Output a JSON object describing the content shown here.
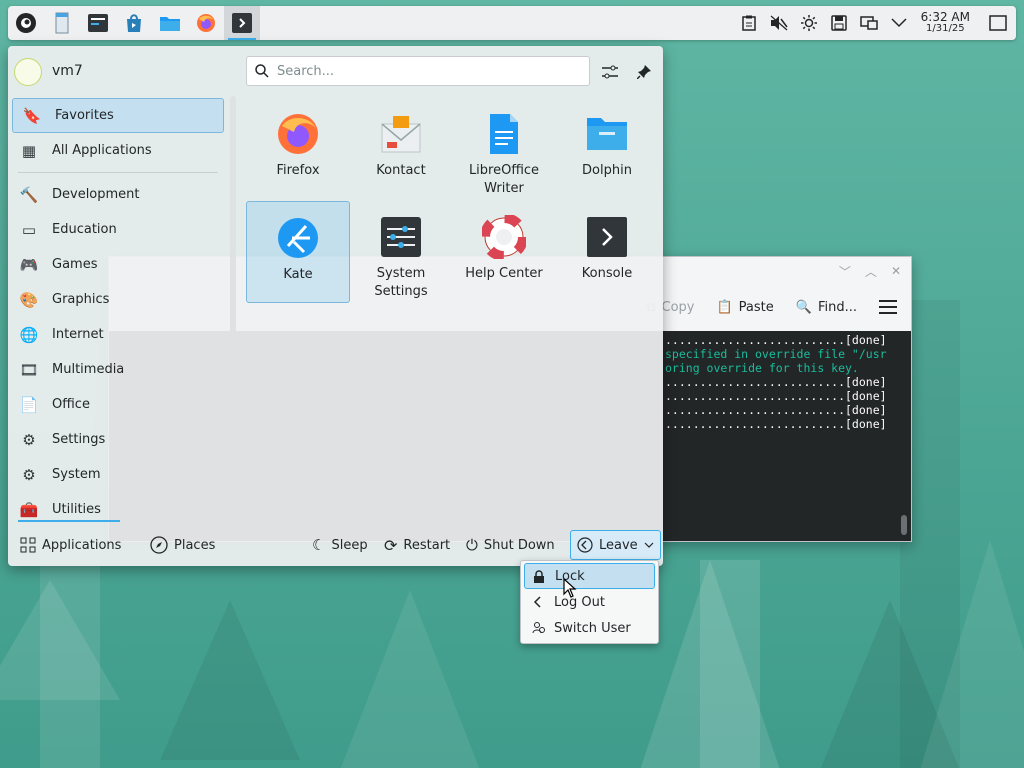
{
  "panel": {
    "clock_time": "6:32 AM",
    "clock_date": "1/31/25"
  },
  "terminal": {
    "toolbar": {
      "copy": "Copy",
      "paste": "Paste",
      "find": "Find..."
    },
    "lines": [
      {
        "text": "..........................[done]",
        "color": "#fcfcfc"
      },
      {
        "text": "specified in override file \"/usr",
        "color": "#1abc9c"
      },
      {
        "text": "oring override for this key.",
        "color": "#1abc9c"
      },
      {
        "text": "..........................[done]",
        "color": "#fcfcfc"
      },
      {
        "text": "..........................[done]",
        "color": "#fcfcfc"
      },
      {
        "text": "..........................[done]",
        "color": "#fcfcfc"
      },
      {
        "text": "..........................[done]",
        "color": "#fcfcfc"
      }
    ]
  },
  "launcher": {
    "username": "vm7",
    "search_placeholder": "Search...",
    "categories": [
      {
        "label": "Favorites",
        "icon": "bookmark-icon",
        "glyph": "🔖",
        "selected": true
      },
      {
        "label": "All Applications",
        "icon": "grid-icon",
        "glyph": "▦",
        "selected": false
      }
    ],
    "categories2": [
      {
        "label": "Development",
        "icon": "hammer-icon",
        "glyph": "🔨"
      },
      {
        "label": "Education",
        "icon": "board-icon",
        "glyph": "▭"
      },
      {
        "label": "Games",
        "icon": "gamepad-icon",
        "glyph": "🎮"
      },
      {
        "label": "Graphics",
        "icon": "palette-icon",
        "glyph": "🎨"
      },
      {
        "label": "Internet",
        "icon": "globe-icon",
        "glyph": "🌐"
      },
      {
        "label": "Multimedia",
        "icon": "film-icon",
        "glyph": "🎞"
      },
      {
        "label": "Office",
        "icon": "document-icon",
        "glyph": "📄"
      },
      {
        "label": "Settings",
        "icon": "sliders-icon",
        "glyph": "⚙"
      },
      {
        "label": "System",
        "icon": "gear-icon",
        "glyph": "⚙"
      },
      {
        "label": "Utilities",
        "icon": "toolbox-icon",
        "glyph": "🧰"
      }
    ],
    "apps": [
      {
        "label": "Firefox",
        "icon": "firefox-icon"
      },
      {
        "label": "Kontact",
        "icon": "kontact-icon"
      },
      {
        "label": "LibreOffice Writer",
        "icon": "writer-icon"
      },
      {
        "label": "Dolphin",
        "icon": "folder-icon"
      },
      {
        "label": "Kate",
        "icon": "kate-icon"
      },
      {
        "label": "System Settings",
        "icon": "settings-icon"
      },
      {
        "label": "Help Center",
        "icon": "lifebuoy-icon"
      },
      {
        "label": "Konsole",
        "icon": "konsole-icon"
      }
    ],
    "footer": {
      "applications": "Applications",
      "places": "Places",
      "sleep": "Sleep",
      "restart": "Restart",
      "shutdown": "Shut Down",
      "leave": "Leave"
    }
  },
  "leave_menu": {
    "items": [
      {
        "label": "Lock",
        "icon": "lock-icon"
      },
      {
        "label": "Log Out",
        "icon": "chevron-left-icon"
      },
      {
        "label": "Switch User",
        "icon": "switch-user-icon"
      }
    ]
  }
}
